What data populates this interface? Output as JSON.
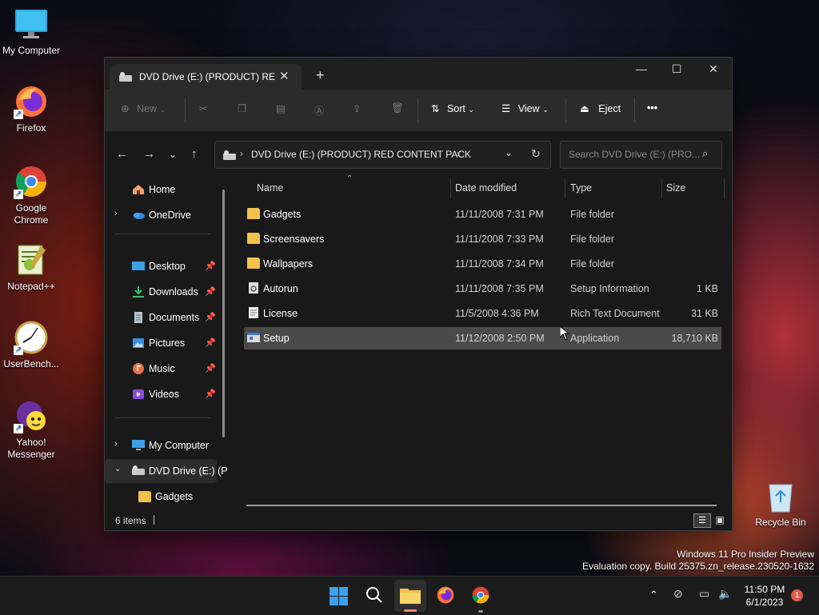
{
  "desktop": {
    "icons": [
      {
        "label": "My Computer"
      },
      {
        "label": "Firefox"
      },
      {
        "label": "Google Chrome"
      },
      {
        "label": "Notepad++"
      },
      {
        "label": "UserBench..."
      },
      {
        "label": "Yahoo! Messenger"
      },
      {
        "label": "Recycle Bin"
      }
    ],
    "watermark": {
      "line1": "Windows 11 Pro Insider Preview",
      "line2": "Evaluation copy. Build 25375.zn_release.230520-1632"
    }
  },
  "window": {
    "tab_title": "DVD Drive (E:) (PRODUCT) RED CONTENT PACK",
    "toolbar": {
      "new_label": "New",
      "sort_label": "Sort",
      "view_label": "View",
      "eject_label": "Eject",
      "more_label": "•••"
    },
    "address": {
      "breadcrumb": "DVD Drive (E:) (PRODUCT) RED CONTENT PACK",
      "search_placeholder": "Search DVD Drive (E:) (PRO..."
    },
    "nav": {
      "home": "Home",
      "onedrive": "OneDrive",
      "quick_access": [
        {
          "label": "Desktop",
          "icon": "desktop-icon"
        },
        {
          "label": "Downloads",
          "icon": "downloads-icon"
        },
        {
          "label": "Documents",
          "icon": "documents-icon"
        },
        {
          "label": "Pictures",
          "icon": "pictures-icon"
        },
        {
          "label": "Music",
          "icon": "music-icon"
        },
        {
          "label": "Videos",
          "icon": "videos-icon"
        }
      ],
      "my_computer": "My Computer",
      "dvd_drive": "DVD Drive (E:) (P",
      "gadgets": "Gadgets"
    },
    "columns": {
      "name": "Name",
      "date": "Date modified",
      "type": "Type",
      "size": "Size"
    },
    "files": [
      {
        "name": "Gadgets",
        "date": "11/11/2008 7:31 PM",
        "type": "File folder",
        "size": "",
        "icon": "folder-icon"
      },
      {
        "name": "Screensavers",
        "date": "11/11/2008 7:33 PM",
        "type": "File folder",
        "size": "",
        "icon": "folder-icon"
      },
      {
        "name": "Wallpapers",
        "date": "11/11/2008 7:34 PM",
        "type": "File folder",
        "size": "",
        "icon": "folder-icon"
      },
      {
        "name": "Autorun",
        "date": "11/11/2008 7:35 PM",
        "type": "Setup Information",
        "size": "1 KB",
        "icon": "setup-info-icon"
      },
      {
        "name": "License",
        "date": "11/5/2008 4:36 PM",
        "type": "Rich Text Document",
        "size": "31 KB",
        "icon": "rtf-document-icon"
      },
      {
        "name": "Setup",
        "date": "11/12/2008 2:50 PM",
        "type": "Application",
        "size": "18,710 KB",
        "icon": "application-icon",
        "selected": true
      }
    ],
    "status": {
      "item_count": "6 items"
    }
  },
  "taskbar": {
    "time": "11:50 PM",
    "date": "6/1/2023",
    "notification_count": "1"
  },
  "colors": {
    "window_bg": "#191919",
    "toolbar_bg": "#2b2b2b",
    "selection": "#4a4a4a",
    "folder": "#f2c14b",
    "accent": "#0a84ff"
  }
}
